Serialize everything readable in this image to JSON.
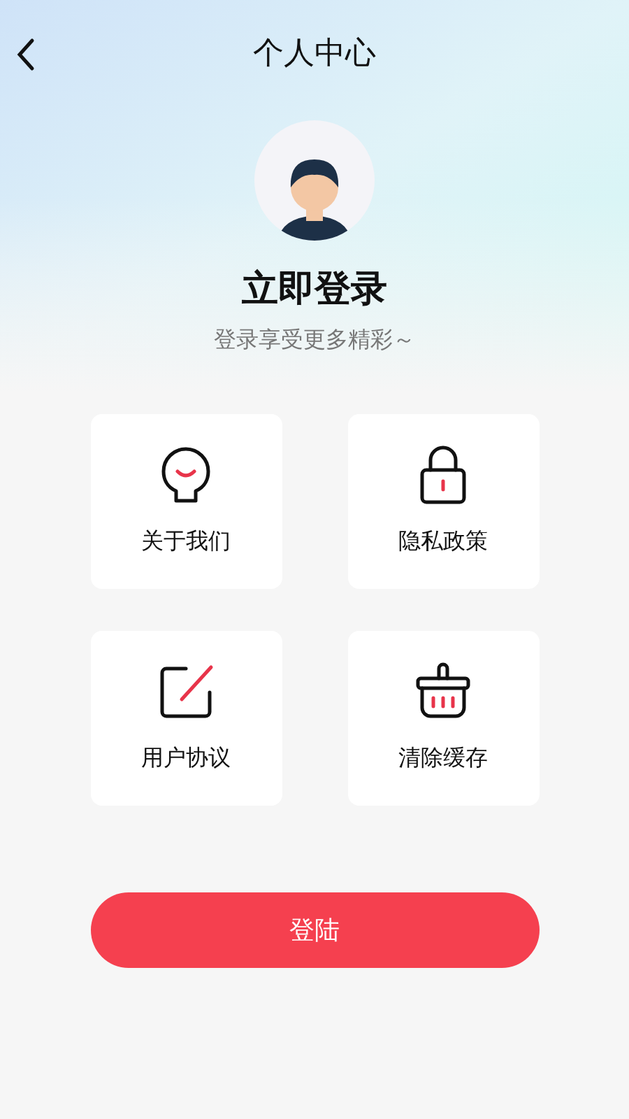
{
  "header": {
    "title": "个人中心"
  },
  "profile": {
    "title": "立即登录",
    "subtitle": "登录享受更多精彩～"
  },
  "menu": [
    {
      "label": "关于我们"
    },
    {
      "label": "隐私政策"
    },
    {
      "label": "用户协议"
    },
    {
      "label": "清除缓存"
    }
  ],
  "login_button": {
    "label": "登陆"
  }
}
